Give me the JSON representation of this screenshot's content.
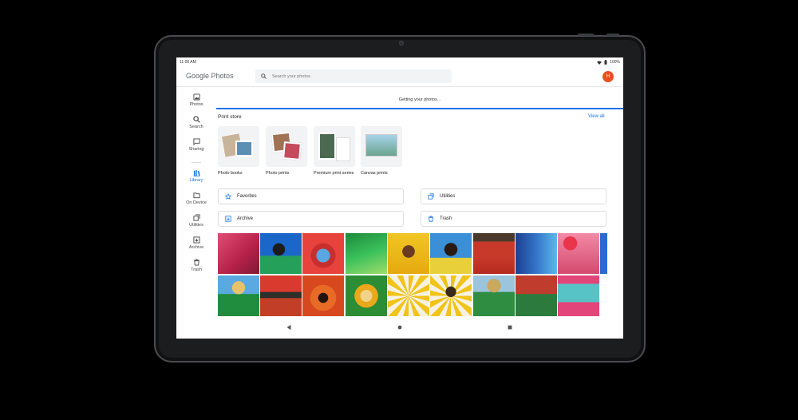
{
  "status_bar": {
    "time": "11:00 AM",
    "battery": "100%"
  },
  "app": {
    "logo_google": "Google",
    "logo_photos": "Photos"
  },
  "search": {
    "placeholder": "Search your photos"
  },
  "account": {
    "avatar_letter": "H"
  },
  "sidebar": {
    "items": [
      {
        "label": "Photos",
        "icon": "photo-icon",
        "active": false
      },
      {
        "label": "Search",
        "icon": "search-icon",
        "active": false
      },
      {
        "label": "Sharing",
        "icon": "chat-icon",
        "active": false
      },
      {
        "label": "Library",
        "icon": "library-icon",
        "active": true
      },
      {
        "label": "On Device",
        "icon": "folder-icon",
        "active": false
      },
      {
        "label": "Utilities",
        "icon": "utilities-icon",
        "active": false
      },
      {
        "label": "Archive",
        "icon": "archive-icon",
        "active": false
      },
      {
        "label": "Trash",
        "icon": "trash-icon",
        "active": false
      }
    ]
  },
  "progress": {
    "text": "Getting your photos..."
  },
  "print_store": {
    "title": "Print store",
    "view_all": "View all",
    "items": [
      {
        "label": "Photo books"
      },
      {
        "label": "Photo prints"
      },
      {
        "label": "Premium print series"
      },
      {
        "label": "Canvas prints"
      }
    ]
  },
  "collections": [
    {
      "label": "Favorites",
      "icon": "star-icon"
    },
    {
      "label": "Utilities",
      "icon": "utilities-icon"
    },
    {
      "label": "Archive",
      "icon": "archive-icon"
    },
    {
      "label": "Trash",
      "icon": "trash-icon"
    }
  ],
  "colors": {
    "accent": "#1a73e8",
    "avatar": "#e8511f",
    "search_bg": "#f1f3f4"
  }
}
